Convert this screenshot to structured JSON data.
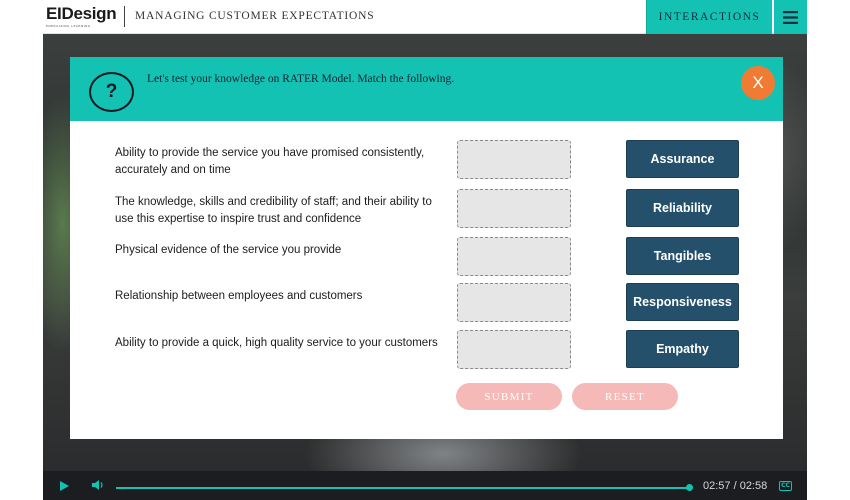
{
  "header": {
    "logo_text": "EIDesign",
    "logo_subtext": "ENERGIZING LEARNING",
    "course_title": "MANAGING CUSTOMER EXPECTATIONS",
    "interactions_label": "INTERACTIONS",
    "menu_icon": "hamburger-menu-icon"
  },
  "modal": {
    "help_icon_glyph": "?",
    "title": "Let's test your knowledge on RATER Model. Match the following.",
    "close_label": "X",
    "prompts": [
      "Ability to provide the service you have promised consistently, accurately and on time",
      "The knowledge, skills and credibility of staff; and their ability to use this expertise to inspire trust and confidence",
      "Physical evidence of the service you provide",
      "Relationship between employees and customers",
      "Ability to provide a quick, high quality service to your customers"
    ],
    "answers": [
      "Assurance",
      "Reliability",
      "Tangibles",
      "Responsiveness",
      "Empathy"
    ],
    "submit_label": "SUBMIT",
    "reset_label": "RESET"
  },
  "player": {
    "time": "02:57 / 02:58",
    "progress": 0.99,
    "cc_label": "CC"
  },
  "colors": {
    "accent": "#14c2b4",
    "answer_bg": "#24506c",
    "close_bg": "#f07c33",
    "disabled_pill": "#f5b9b7"
  }
}
